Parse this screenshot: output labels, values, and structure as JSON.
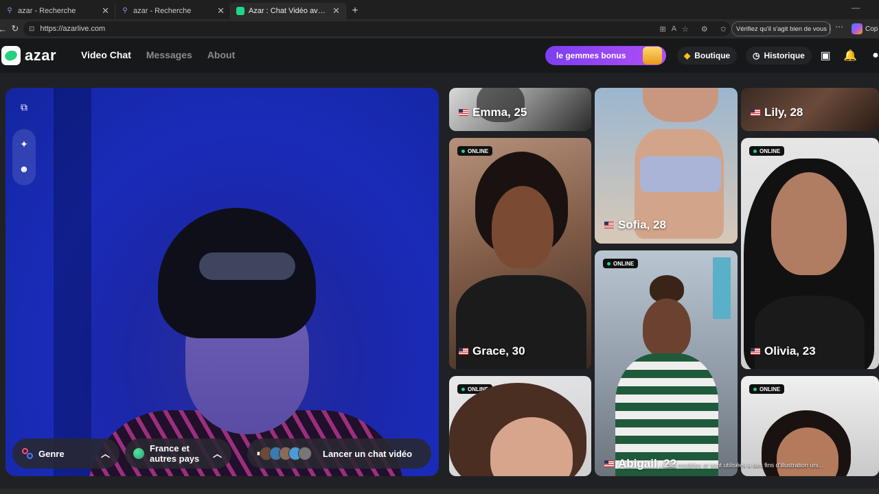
{
  "browser": {
    "tabs": [
      {
        "title": "azar - Recherche",
        "active": false
      },
      {
        "title": "azar - Recherche",
        "active": false
      },
      {
        "title": "Azar : Chat Vidéo avec de nou",
        "active": true
      }
    ],
    "url": "https://azarlive.com",
    "verify_label": "Vérifiez qu'il s'agit bien de vous",
    "copilot_label": "Cop"
  },
  "site": {
    "logo": "azar",
    "nav": [
      "Video Chat",
      "Messages",
      "About"
    ],
    "gems_label": "le gemmes bonus",
    "boutique": "Boutique",
    "historique": "Historique"
  },
  "controls": {
    "genre": "Genre",
    "pays_line1": "France et",
    "pays_line2": "autres pays",
    "launch": "Lancer un chat vidéo"
  },
  "cards": [
    {
      "name": "Emma, 25",
      "online_label": ""
    },
    {
      "name": "Sofia, 28",
      "online_label": ""
    },
    {
      "name": "Lily, 28",
      "online_label": ""
    },
    {
      "name": "Grace, 30",
      "online_label": "ONLINE"
    },
    {
      "name": "Olivia, 23",
      "online_label": "ONLINE"
    },
    {
      "name": "Abigail, 22",
      "online_label": "ONLINE"
    },
    {
      "name": "",
      "online_label": "ONLINE"
    },
    {
      "name": "",
      "online_label": "ONLINE"
    }
  ],
  "disclaimer": "...t des modèles et sont utilisées à des fins d'illustration uni...",
  "colors": {
    "accent": "#26d07c",
    "gems": "#9b45f4",
    "online_dot": "#1fd68a"
  }
}
